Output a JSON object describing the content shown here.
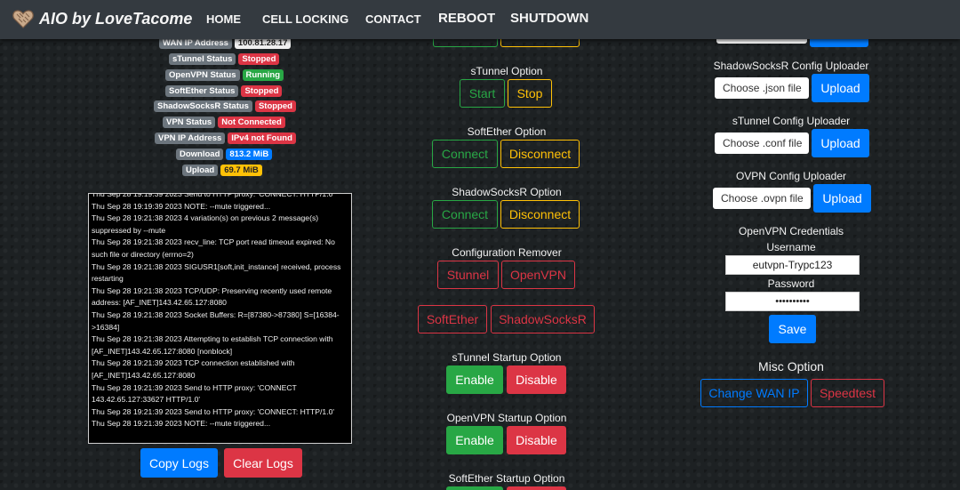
{
  "nav": {
    "brand": "AIO by LoveTacome",
    "links": [
      "HOME",
      "CELL LOCKING",
      "CONTACT",
      "REBOOT",
      "SHUTDOWN"
    ]
  },
  "status": {
    "wan_ip": {
      "label": "WAN IP Address",
      "value": "100.81.28.17"
    },
    "stunnel": {
      "label": "sTunnel Status",
      "value": "Stopped"
    },
    "openvpn": {
      "label": "OpenVPN Status",
      "value": "Running"
    },
    "softether": {
      "label": "SoftEther Status",
      "value": "Stopped"
    },
    "shadowsocksr": {
      "label": "ShadowSocksR Status",
      "value": "Stopped"
    },
    "vpn": {
      "label": "VPN Status",
      "value": "Not Connected"
    },
    "vpn_ip": {
      "label": "VPN IP Address",
      "value": "IPv4 not Found"
    },
    "download": {
      "label": "Download",
      "value": "813.2 MiB"
    },
    "upload": {
      "label": "Upload",
      "value": "69.7 MiB"
    }
  },
  "log": {
    "lines": [
      "Thu Sep 28 19:19:39 2023 Send to HTTP proxy: 'CONNECT: HTTP/1.0'",
      "Thu Sep 28 19:19:39 2023 NOTE: --mute triggered...",
      "Thu Sep 28 19:21:38 2023 4 variation(s) on previous 2 message(s) suppressed by --mute",
      "Thu Sep 28 19:21:38 2023 recv_line: TCP port read timeout expired: No such file or directory (errno=2)",
      "Thu Sep 28 19:21:38 2023 SIGUSR1[soft,init_instance] received, process restarting",
      "Thu Sep 28 19:21:38 2023 TCP/UDP: Preserving recently used remote address: [AF_INET]143.42.65.127:8080",
      "Thu Sep 28 19:21:38 2023 Socket Buffers: R=[87380->87380] S=[16384->16384]",
      "Thu Sep 28 19:21:38 2023 Attempting to establish TCP connection with [AF_INET]143.42.65.127:8080 [nonblock]",
      "Thu Sep 28 19:21:39 2023 TCP connection established with [AF_INET]143.42.65.127:8080",
      "Thu Sep 28 19:21:39 2023 Send to HTTP proxy: 'CONNECT 143.42.65.127:33627 HTTP/1.0'",
      "Thu Sep 28 19:21:39 2023 Send to HTTP proxy: 'CONNECT: HTTP/1.0'",
      "Thu Sep 28 19:21:39 2023 NOTE: --mute triggered..."
    ],
    "copy_label": "Copy Logs",
    "clear_label": "Clear Logs"
  },
  "middle": {
    "stunnel_option": {
      "title": "sTunnel Option",
      "start": "Start",
      "stop": "Stop"
    },
    "softether_option": {
      "title": "SoftEther Option",
      "connect": "Connect",
      "disconnect": "Disconnect"
    },
    "shadowsocksr_option": {
      "title": "ShadowSocksR Option",
      "connect": "Connect",
      "disconnect": "Disconnect"
    },
    "config_remover": {
      "title": "Configuration Remover",
      "stunnel": "Stunnel",
      "openvpn": "OpenVPN",
      "softether": "SoftEther",
      "shadowsocksr": "ShadowSocksR"
    },
    "stunnel_startup": {
      "title": "sTunnel Startup Option",
      "enable": "Enable",
      "disable": "Disable"
    },
    "openvpn_startup": {
      "title": "OpenVPN Startup Option",
      "enable": "Enable",
      "disable": "Disable"
    },
    "softether_startup": {
      "title": "SoftEther Startup Option"
    }
  },
  "right": {
    "ssr_uploader": {
      "title": "ShadowSocksR Config Uploader",
      "choose": "Choose .json file",
      "upload": "Upload"
    },
    "stunnel_uploader": {
      "title": "sTunnel Config Uploader",
      "choose": "Choose .conf file",
      "upload": "Upload"
    },
    "ovpn_uploader": {
      "title": "OVPN Config Uploader",
      "choose": "Choose .ovpn file",
      "upload": "Upload"
    },
    "credentials": {
      "title": "OpenVPN Credentials",
      "username_label": "Username",
      "username_value": "eutvpn-Trypc123",
      "password_label": "Password",
      "password_value": "••••••••••",
      "save": "Save"
    },
    "misc": {
      "title": "Misc Option",
      "change_wan": "Change WAN IP",
      "speedtest": "Speedtest"
    }
  }
}
